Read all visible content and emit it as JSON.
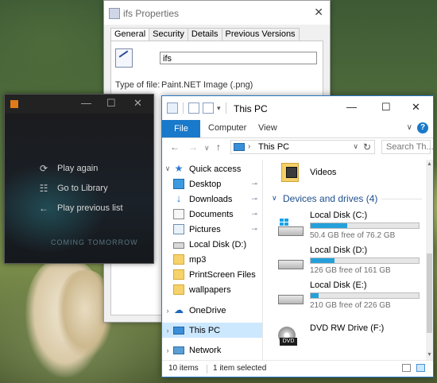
{
  "properties": {
    "title": "ifs Properties",
    "close": "✕",
    "tabs": [
      "General",
      "Security",
      "Details",
      "Previous Versions"
    ],
    "filename": "ifs",
    "type_label": "Type of file:",
    "type_value": "Paint.NET Image (.png)"
  },
  "player": {
    "minimize": "—",
    "maximize": "☐",
    "close": "✕",
    "poster_text": "COMING TOMORROW",
    "menu": [
      {
        "icon": "⟳",
        "label": "Play again"
      },
      {
        "icon": "☷",
        "label": "Go to Library"
      },
      {
        "icon": "←",
        "label": "Play previous list"
      }
    ]
  },
  "explorer": {
    "title": "This PC",
    "window_controls": {
      "minimize": "—",
      "maximize": "☐",
      "close": "✕"
    },
    "ribbon": {
      "file": "File",
      "computer": "Computer",
      "view": "View",
      "expand": "∨",
      "help": "?"
    },
    "nav": {
      "back": "←",
      "forward": "→",
      "recent": "∨",
      "up": "↑"
    },
    "address": {
      "chevron": "›",
      "path": "This PC",
      "dropdown": "∨",
      "refresh": "↻"
    },
    "search_placeholder": "Search Th...",
    "tree": [
      {
        "label": "Quick access",
        "icon": "star-icon",
        "expand": "∨",
        "pinned": false
      },
      {
        "label": "Desktop",
        "icon": "desktop-icon",
        "pinned": true
      },
      {
        "label": "Downloads",
        "icon": "downloads-icon",
        "pinned": true
      },
      {
        "label": "Documents",
        "icon": "documents-icon",
        "pinned": true
      },
      {
        "label": "Pictures",
        "icon": "pictures-icon",
        "pinned": true
      },
      {
        "label": "Local Disk (D:)",
        "icon": "disk-icon",
        "pinned": false
      },
      {
        "label": "mp3",
        "icon": "folder-icon",
        "pinned": false
      },
      {
        "label": "PrintScreen Files",
        "icon": "folder-icon",
        "pinned": false
      },
      {
        "label": "wallpapers",
        "icon": "folder-icon",
        "pinned": false
      },
      {
        "label": "OneDrive",
        "icon": "onedrive-icon",
        "expand": "›",
        "pinned": false
      },
      {
        "label": "This PC",
        "icon": "this-pc-icon",
        "expand": "›",
        "pinned": false,
        "selected": true
      },
      {
        "label": "Network",
        "icon": "network-icon",
        "expand": "›",
        "pinned": false
      }
    ],
    "pin_glyph": "📌",
    "folders": [
      {
        "label": "Videos",
        "icon": "videos-folder-icon"
      }
    ],
    "devices_header": "Devices and drives (4)",
    "drives": [
      {
        "name": "Local Disk (C:)",
        "free": "50.4 GB free of 76.2 GB",
        "used_fraction": 0.34,
        "icon": "windows-drive-icon"
      },
      {
        "name": "Local Disk (D:)",
        "free": "126 GB free of 161 GB",
        "used_fraction": 0.22,
        "icon": "drive-icon"
      },
      {
        "name": "Local Disk (E:)",
        "free": "210 GB free of 226 GB",
        "used_fraction": 0.07,
        "icon": "drive-icon"
      }
    ],
    "dvd": {
      "name": "DVD RW Drive (F:)",
      "label": "DVD"
    },
    "status": {
      "items": "10 items",
      "selected": "1 item selected"
    },
    "colors": {
      "accent": "#1979ca",
      "bar_fill": "#26a0da",
      "selection": "#cce8ff"
    }
  }
}
